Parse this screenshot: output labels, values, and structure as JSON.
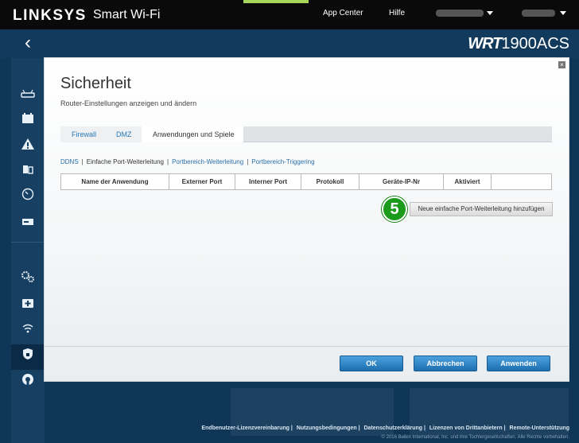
{
  "header": {
    "logo": "LINKSYS",
    "product": "Smart Wi-Fi",
    "links": [
      "App Center",
      "Hilfe"
    ]
  },
  "subheader": {
    "back_glyph": "‹",
    "model_prefix": "WRT",
    "model_suffix": "1900ACS"
  },
  "sidebar": {
    "icons": [
      "router-icon",
      "devices-icon",
      "alert-icon",
      "parental-controls-icon",
      "speed-test-icon",
      "storage-icon",
      "settings-icon",
      "media-prioritization-icon",
      "wifi-icon",
      "security-icon",
      "openvpn-icon"
    ],
    "active_item": "security-icon"
  },
  "modal": {
    "close_glyph": "×",
    "title": "Sicherheit",
    "subtitle": "Router-Einstellungen anzeigen und ändern",
    "tabs": [
      "Firewall",
      "DMZ",
      "Anwendungen und Spiele"
    ],
    "active_tab": "Anwendungen und Spiele",
    "subtabs": [
      "DDNS",
      "Einfache Port-Weiterleitung",
      "Portbereich-Weiterleitung",
      "Portbereich-Triggering"
    ],
    "active_subtab": "Einfache Port-Weiterleitung",
    "table_columns": [
      "Name der Anwendung",
      "Externer Port",
      "Interner Port",
      "Protokoll",
      "Geräte-IP-Nr",
      "Aktiviert"
    ],
    "add_button": "Neue einfache Port-Weiterleitung hinzufügen",
    "step_badge": "5",
    "buttons": {
      "ok": "OK",
      "cancel": "Abbrechen",
      "apply": "Anwenden"
    }
  },
  "footer": {
    "links": [
      "Endbenutzer-Lizenzvereinbarung",
      "Nutzungsbedingungen",
      "Datenschutzerklärung",
      "Lizenzen von Drittanbietern",
      "Remote-Unterstützung"
    ],
    "copyright": "© 2016 Belkin International, Inc. und ihre Tochtergesellschaften. Alle Rechte vorbehalten."
  },
  "colors": {
    "accent_green": "#a7d65a",
    "button_blue": "#2a84c8",
    "link_blue": "#2a7ab8",
    "step_green": "#1b9a1b"
  }
}
